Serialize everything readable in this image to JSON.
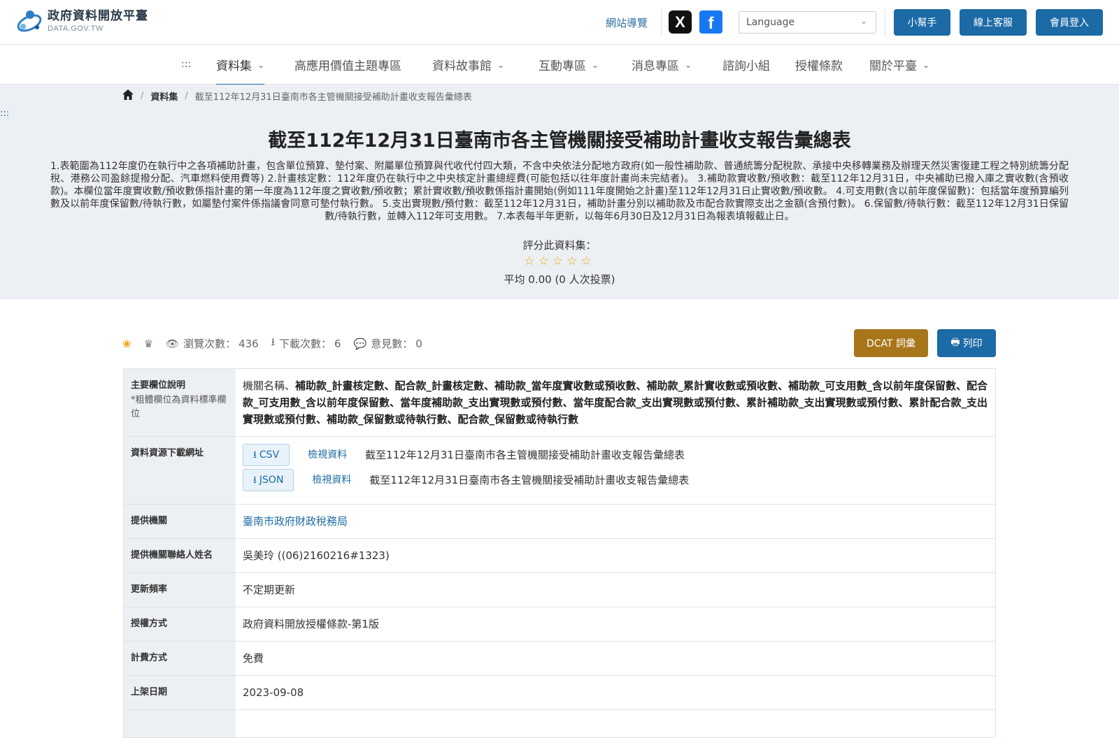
{
  "header": {
    "logo_title": "政府資料開放平臺",
    "logo_sub": "DATA.GOV.TW",
    "sitemap": "網站導覽",
    "social_x": "X",
    "social_fb": "f",
    "language_placeholder": "Language",
    "buttons": {
      "helper": "小幫手",
      "service": "線上客服",
      "login": "會員登入"
    }
  },
  "nav": {
    "accesskey": ":::",
    "items": [
      "資料集",
      "高應用價值主題專區",
      "資料故事館",
      "互動專區",
      "消息專區",
      "諮詢小組",
      "授權條款",
      "關於平臺"
    ]
  },
  "breadcrumb": {
    "section": "資料集",
    "current": "截至112年12月31日臺南市各主管機關接受補助計畫收支報告彙總表"
  },
  "hero": {
    "accesskey": ":::",
    "title": "截至112年12月31日臺南市各主管機關接受補助計畫收支報告彙總表",
    "description": "1.表範圍為112年度仍在執行中之各項補助計畫，包含單位預算、墊付案、附屬單位預算與代收代付四大類，不含中央依法分配地方政府(如一般性補助款、普通統籌分配稅款、承接中央移轉業務及辦理天然災害復建工程之特別統籌分配稅、港務公司盈餘提撥分配、汽車燃料使用費等) 2.計畫核定數：112年度仍在執行中之中央核定計畫總經費(可能包括以往年度計畫尚未完結者)。 3.補助款實收數/預收數：截至112年12月31日，中央補助已撥入庫之實收數(含預收款)。本欄位當年度實收數/預收數係指計畫的第一年度為112年度之實收數/預收數；累計實收數/預收數係指計畫開始(例如111年度開始之計畫)至112年12月31日止實收數/預收數。 4.可支用數(含以前年度保留數)：包括當年度預算編列數及以前年度保留數/待執行數，如屬墊付案件係指議會同意可墊付執行數。 5.支出實現數/預付數：截至112年12月31日，補助計畫分別以補助款及市配合款實際支出之金額(含預付數)。 6.保留數/待執行數：截至112年12月31日保留數/待執行數，並轉入112年可支用數。 7.本表每半年更新，以每年6月30日及12月31日為報表填報截止日。",
    "rate_label": "評分此資料集：",
    "stars": "☆☆☆☆☆",
    "rating_avg": "平均 0.00 (0 人次投票)"
  },
  "stats": {
    "views_label": "瀏覽次數：",
    "views": "436",
    "downloads_label": "下載次數：",
    "downloads": "6",
    "comments_label": "意見數：",
    "comments": "0",
    "dcat": "DCAT 詞彙",
    "print": "列印"
  },
  "table": {
    "fields_label": "主要欄位說明",
    "fields_hint": "*粗體欄位為資料標準欄位",
    "fields_first": "機關名稱、",
    "fields_bold": "補助款_計畫核定數、配合款_計畫核定數、補助款_當年度實收數或預收數、補助款_累計實收數或預收數、補助款_可支用數_含以前年度保留數、配合款_可支用數_含以前年度保留數、當年度補助款_支出實現數或預付數、當年度配合款_支出實現數或預付數、累計補助款_支出實現數或預付數、累計配合款_支出實現數或預付數、補助款_保留數或待執行數、配合款_保留數或待執行數",
    "download_label": "資料資源下載網址",
    "downloads": [
      {
        "format": "CSV",
        "view": "檢視資料",
        "name": "截至112年12月31日臺南市各主管機關接受補助計畫收支報告彙總表"
      },
      {
        "format": "JSON",
        "view": "檢視資料",
        "name": "截至112年12月31日臺南市各主管機關接受補助計畫收支報告彙總表"
      }
    ],
    "provider_label": "提供機關",
    "provider": "臺南市政府財政稅務局",
    "contact_label": "提供機關聯絡人姓名",
    "contact": "吳美玲 ((06)2160216#1323)",
    "frequency_label": "更新頻率",
    "frequency": "不定期更新",
    "license_label": "授權方式",
    "license": "政府資料開放授權條款-第1版",
    "fee_label": "計費方式",
    "fee": "免費",
    "published_label": "上架日期",
    "published": "2023-09-08"
  }
}
